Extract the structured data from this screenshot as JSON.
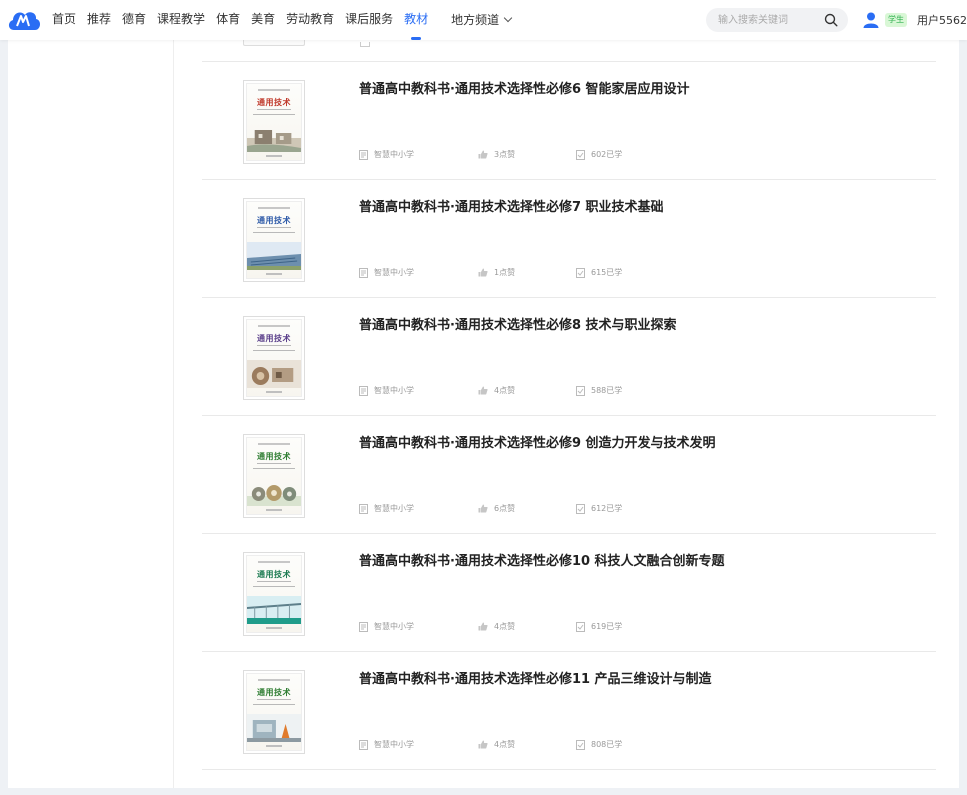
{
  "nav": {
    "items": [
      {
        "label": "首页",
        "active": false
      },
      {
        "label": "推荐",
        "active": false
      },
      {
        "label": "德育",
        "active": false
      },
      {
        "label": "课程教学",
        "active": false
      },
      {
        "label": "体育",
        "active": false
      },
      {
        "label": "美育",
        "active": false
      },
      {
        "label": "劳动教育",
        "active": false
      },
      {
        "label": "课后服务",
        "active": false
      },
      {
        "label": "教材",
        "active": true
      }
    ],
    "dropdown_label": "地方频道"
  },
  "search": {
    "placeholder": "输入搜索关键词"
  },
  "user": {
    "role_badge": "学生",
    "name": "用户5562"
  },
  "colors": {
    "accent": "#2a6df4",
    "badge_bg": "#d9f7d6",
    "badge_text": "#2fb14f"
  },
  "textbooks": [
    {
      "title": "普通高中教科书·通用技术选择性必修6 智能家居应用设计",
      "source": "智慧中小学",
      "likes": "3点赞",
      "learned": "602已学",
      "cover_title": "通用技术",
      "cover_color": "#c0392b",
      "cover_scene": "house"
    },
    {
      "title": "普通高中教科书·通用技术选择性必修7 职业技术基础",
      "source": "智慧中小学",
      "likes": "1点赞",
      "learned": "615已学",
      "cover_title": "通用技术",
      "cover_color": "#2e5aa8",
      "cover_scene": "solar"
    },
    {
      "title": "普通高中教科书·通用技术选择性必修8 技术与职业探索",
      "source": "智慧中小学",
      "likes": "4点赞",
      "learned": "588已学",
      "cover_title": "通用技术",
      "cover_color": "#5a3f8a",
      "cover_scene": "workshop"
    },
    {
      "title": "普通高中教科书·通用技术选择性必修9 创造力开发与技术发明",
      "source": "智慧中小学",
      "likes": "6点赞",
      "learned": "612已学",
      "cover_title": "通用技术",
      "cover_color": "#2e7d32",
      "cover_scene": "gears"
    },
    {
      "title": "普通高中教科书·通用技术选择性必修10 科技人文融合创新专题",
      "source": "智慧中小学",
      "likes": "4点赞",
      "learned": "619已学",
      "cover_title": "通用技术",
      "cover_color": "#1b7a50",
      "cover_scene": "bridge"
    },
    {
      "title": "普通高中教科书·通用技术选择性必修11 产品三维设计与制造",
      "source": "智慧中小学",
      "likes": "4点赞",
      "learned": "808已学",
      "cover_title": "通用技术",
      "cover_color": "#2e7d32",
      "cover_scene": "machine"
    }
  ]
}
